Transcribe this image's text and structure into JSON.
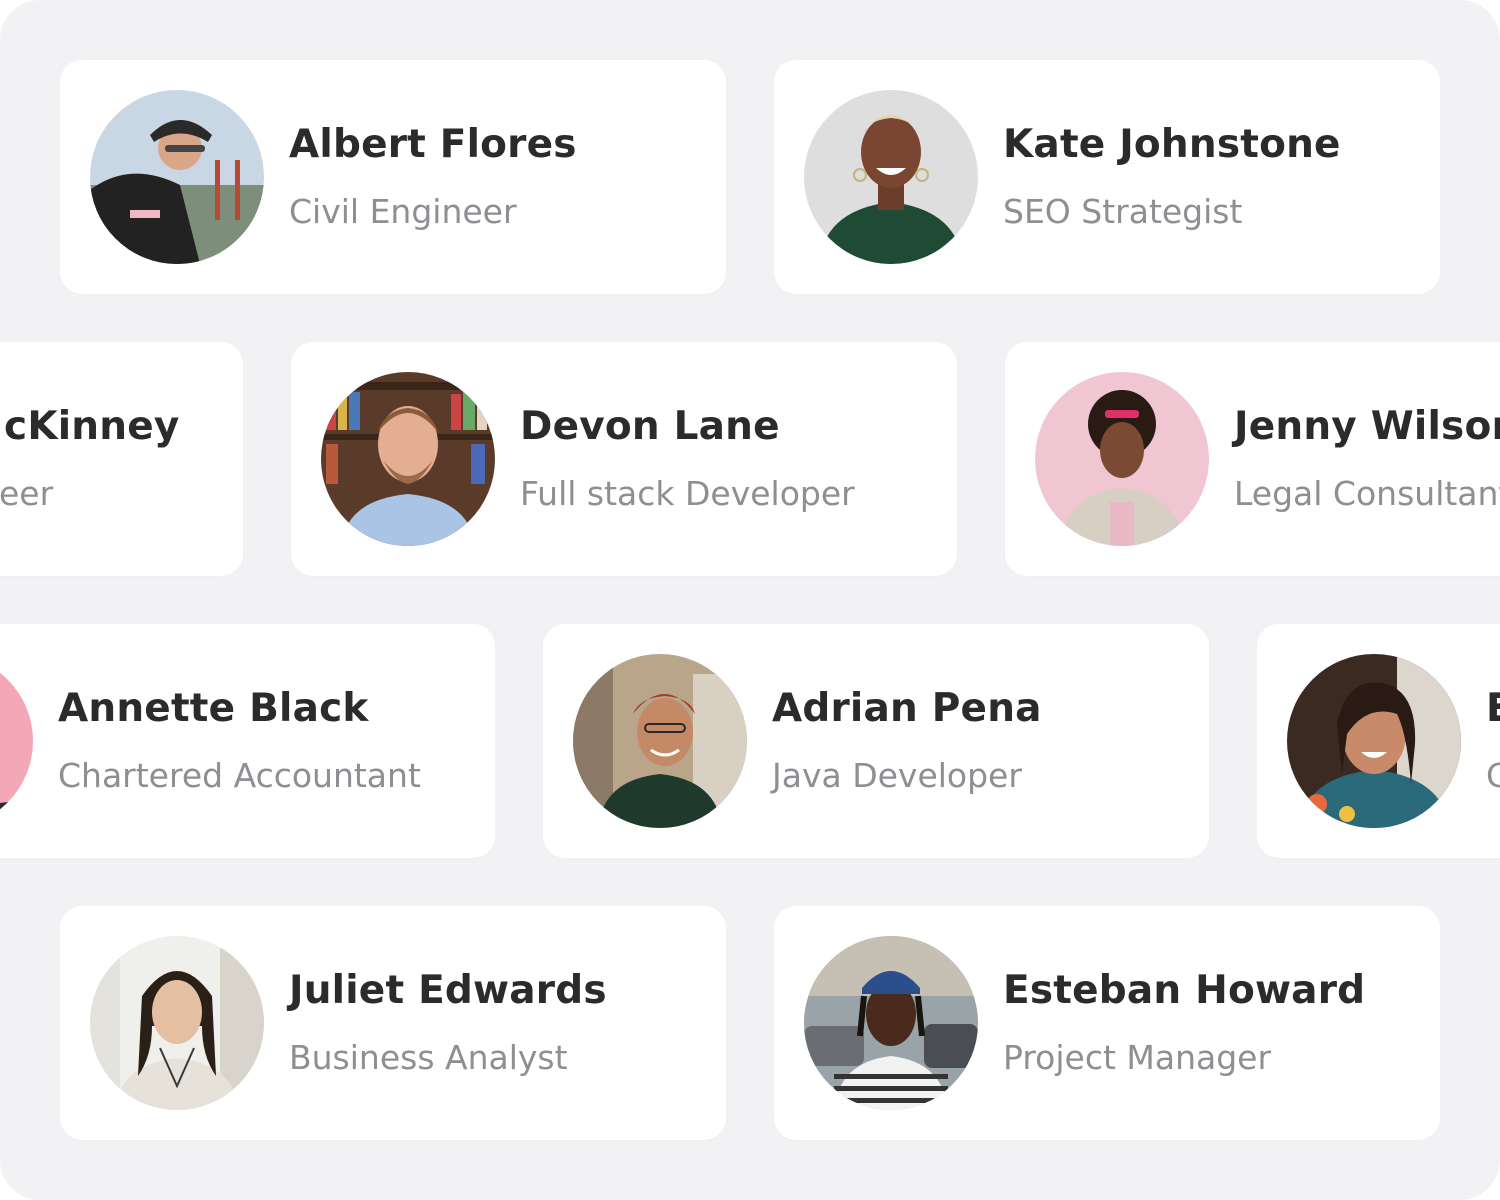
{
  "cards": [
    {
      "name": "Albert Flores",
      "role": "Civil Engineer"
    },
    {
      "name": "Kate Johnstone",
      "role": "SEO Strategist"
    },
    {
      "name": "cKinney",
      "role": "eer"
    },
    {
      "name": "Devon Lane",
      "role": "Full stack Developer"
    },
    {
      "name": "Jenny Wilson",
      "role": "Legal Consultant"
    },
    {
      "name": "Annette Black",
      "role": "Chartered Accountant"
    },
    {
      "name": "Adrian Pena",
      "role": "Java Developer"
    },
    {
      "name": "E",
      "role": "C"
    },
    {
      "name": "Juliet Edwards",
      "role": "Business Analyst"
    },
    {
      "name": "Esteban Howard",
      "role": "Project Manager"
    }
  ],
  "colors": {
    "page_background": "#f2f2f4",
    "card_background": "#ffffff",
    "name_text": "#2b2b2e",
    "role_text": "#8e8e93"
  }
}
